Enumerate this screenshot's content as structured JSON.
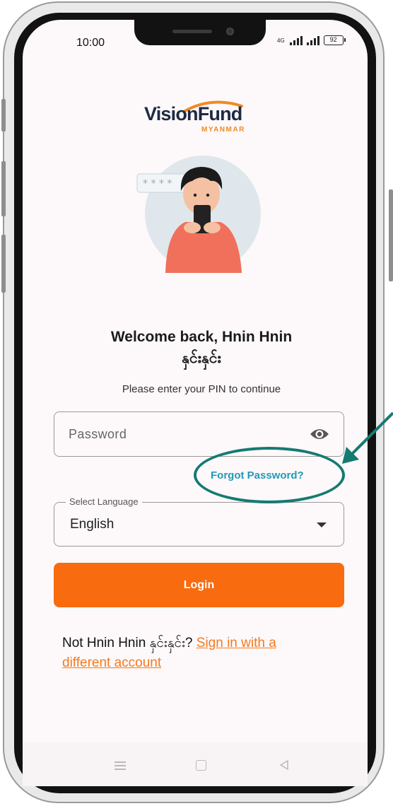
{
  "status_bar": {
    "time": "10:00",
    "network": "4G",
    "battery": "92"
  },
  "brand": {
    "name": "VisionFund",
    "region": "MYANMAR",
    "arc_color": "#f08a24",
    "text_color": "#1c2a44"
  },
  "welcome": {
    "title": "Welcome back, Hnin Hnin",
    "name_mm": "နှင်းနှင်း",
    "subtitle": "Please enter your PIN to continue"
  },
  "password_field": {
    "placeholder": "Password",
    "value": "",
    "toggle_icon": "eye-icon"
  },
  "forgot_password": "Forgot Password?",
  "language_select": {
    "label": "Select Language",
    "selected": "English"
  },
  "login_button": "Login",
  "switch_account": {
    "prefix": "Not Hnin Hnin နှင်းနှင်း? ",
    "link": "Sign in with a different account"
  },
  "colors": {
    "primary": "#f86b0e",
    "link": "#1f9bb8",
    "annotation": "#167a72"
  },
  "nav_icons": [
    "menu-icon",
    "home-icon",
    "back-icon"
  ]
}
